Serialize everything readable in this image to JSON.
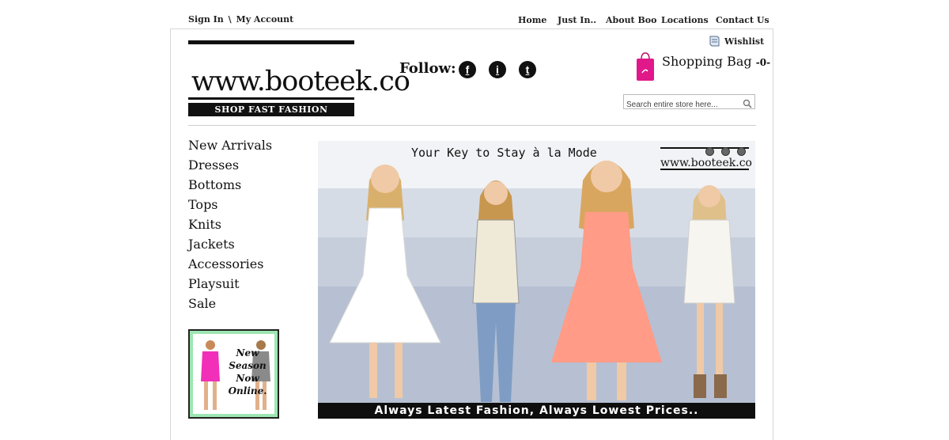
{
  "account": {
    "sign_in": "Sign In",
    "separator": "\\",
    "my_account": "My Account"
  },
  "topnav": {
    "items": [
      {
        "label": "Home"
      },
      {
        "label": "Just In.."
      },
      {
        "label": "About Boo"
      },
      {
        "label": "Locations"
      },
      {
        "label": "Contact Us"
      }
    ]
  },
  "logo": {
    "text": "www.booteek.co",
    "tagline": "SHOP FAST FASHION"
  },
  "social": {
    "label": "Follow:",
    "icons": [
      {
        "icon": "facebook-icon",
        "glyph": "f"
      },
      {
        "icon": "info-icon",
        "glyph": "i"
      },
      {
        "icon": "twitter-icon",
        "glyph": "t"
      }
    ]
  },
  "wishlist": {
    "label": "Wishlist"
  },
  "bag": {
    "label": "Shopping Bag",
    "count": "-0-",
    "color": "#e0188a"
  },
  "search": {
    "placeholder": "Search entire store here..."
  },
  "sidebar": {
    "items": [
      {
        "label": "New Arrivals"
      },
      {
        "label": "Dresses"
      },
      {
        "label": "Bottoms"
      },
      {
        "label": "Tops"
      },
      {
        "label": "Knits"
      },
      {
        "label": "Jackets"
      },
      {
        "label": "Accessories"
      },
      {
        "label": "Playsuit"
      },
      {
        "label": "Sale"
      }
    ],
    "promo": {
      "line1": "New",
      "line2": "Season",
      "line3": "Now",
      "line4": "Online."
    }
  },
  "banner": {
    "tagline": "Your Key to Stay à la Mode",
    "logo_text": "www.booteek.co",
    "footer": "Always Latest Fashion, Always Lowest Prices..",
    "slides": 3
  },
  "colors": {
    "pink": "#e0188a",
    "dark": "#111111",
    "border": "#d6d6d6"
  }
}
